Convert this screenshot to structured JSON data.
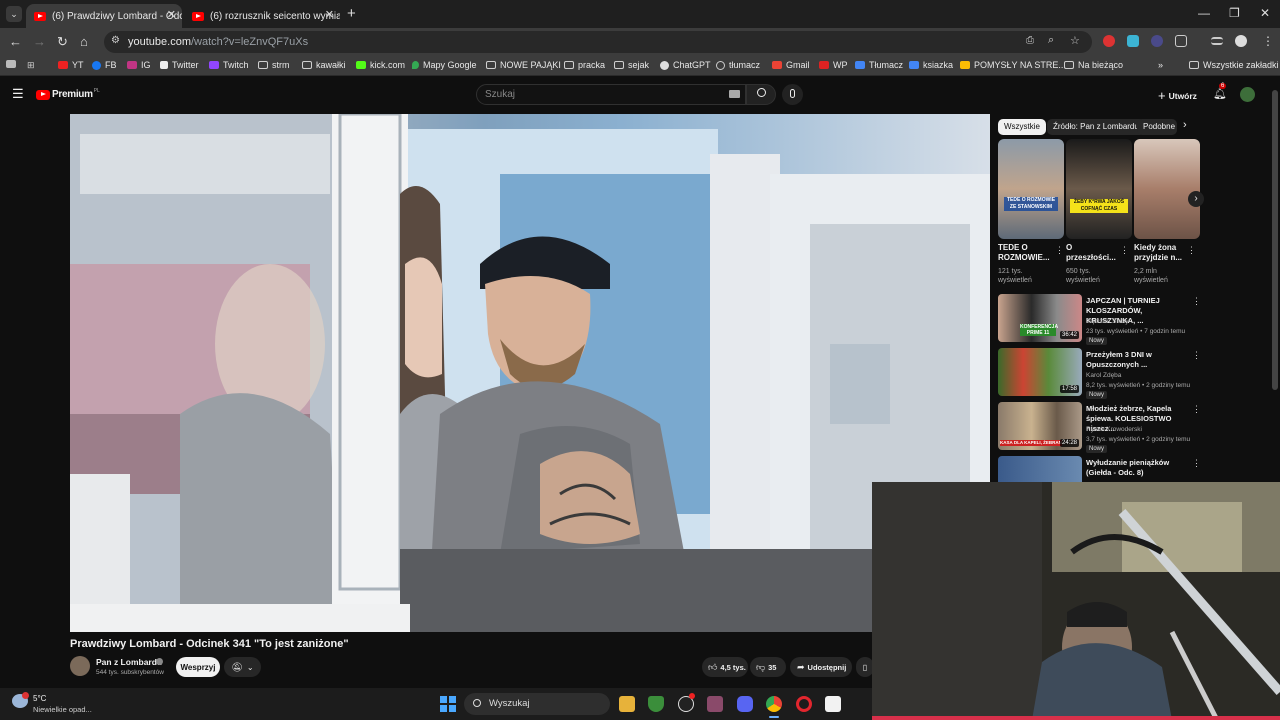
{
  "browser": {
    "tabs": [
      {
        "title": "(6) Prawdziwy Lombard - Odcin",
        "active": true
      },
      {
        "title": "(6) rozrusznik seicento wymiana",
        "active": false
      }
    ],
    "new_tab": "+",
    "url_host": "youtube.com",
    "url_path": "/watch?v=leZnvQF7uXs",
    "bookmarks": [
      "YT",
      "FB",
      "IG",
      "Twitter",
      "Twitch",
      "strm",
      "kawałki",
      "kick.com",
      "Mapy Google",
      "NOWE PAJĄKI",
      "pracka",
      "sejak",
      "ChatGPT",
      "tłumacz",
      "Gmail",
      "WP",
      "Tłumacz",
      "ksiazka",
      "POMYSŁY NA STRE..."
    ],
    "bookmarks_extra": [
      "Na bieżąco",
      "Wszystkie zakładki"
    ]
  },
  "youtube": {
    "logo_text": "Premium",
    "logo_badge": "PL",
    "search_placeholder": "Szukaj",
    "create_label": "Utwórz",
    "notifications_count": "6",
    "video": {
      "title": "Prawdziwy Lombard - Odcinek 341 \"To jest zaniżone\"",
      "channel": "Pan z Lombardu",
      "subscribers": "544 tys. subskrybentów",
      "support_label": "Wesprzyj",
      "likes": "4,5 tys.",
      "dislikes": "35",
      "share_label": "Udostępnij"
    },
    "chips": [
      "Wszystkie",
      "Źródło: Pan z Lombardu",
      "Podobne"
    ],
    "shorts": [
      {
        "title": "TEDE O ROZMOWIE...",
        "views": "121 tys. wyświetleń",
        "overlay": "TEDE O ROZMOWIE ZE STANOWSKIM"
      },
      {
        "title": "O przeszłości...",
        "views": "650 tys. wyświetleń",
        "overlay": "ŻEBY K*RWA JAKOŚ COFNĄĆ CZAS"
      },
      {
        "title": "Kiedy żona przyjdzie n...",
        "views": "2,2 mln wyświetleń",
        "overlay": ""
      }
    ],
    "related": [
      {
        "title": "JAPCZAN | TURNIEJ KLOSZARDÓW, KRUSZYNKA, ...",
        "channel": "Japczan Shoty",
        "meta": "23 tys. wyświetleń • 7 godzin temu",
        "badge": "Nowy",
        "duration": "36:42",
        "thumb_text": "KONFERENCJA PRIME 11"
      },
      {
        "title": "Przeżyłem 3 DNI w Opuszczonych ...",
        "channel": "Karol Zdęba",
        "meta": "8,2 tys. wyświetleń • 2 godziny temu",
        "badge": "Nowy",
        "duration": "17:58",
        "thumb_text": ""
      },
      {
        "title": "Młodzież żebrze, Kapela śpiewa. KOLESIOSTWO niszcz...",
        "channel": "Rynek Krowoderski",
        "meta": "3,7 tys. wyświetleń • 2 godziny temu",
        "badge": "Nowy",
        "duration": "24:28",
        "thumb_text": "KASA DLA KAPELI, ŻEBRANIE DLA..."
      },
      {
        "title": "Wyłudzanie pieniążków (Giełda - Odc. 8)",
        "channel": "",
        "meta": "",
        "badge": "",
        "duration": "",
        "thumb_text": ""
      }
    ]
  },
  "taskbar": {
    "weather_temp": "5°C",
    "weather_desc": "Niewielkie opad...",
    "search_placeholder": "Wyszukaj"
  },
  "colors": {
    "yt_red": "#ff0000",
    "bg": "#0f0f0f",
    "chrome_bar": "#3c3c3c"
  }
}
